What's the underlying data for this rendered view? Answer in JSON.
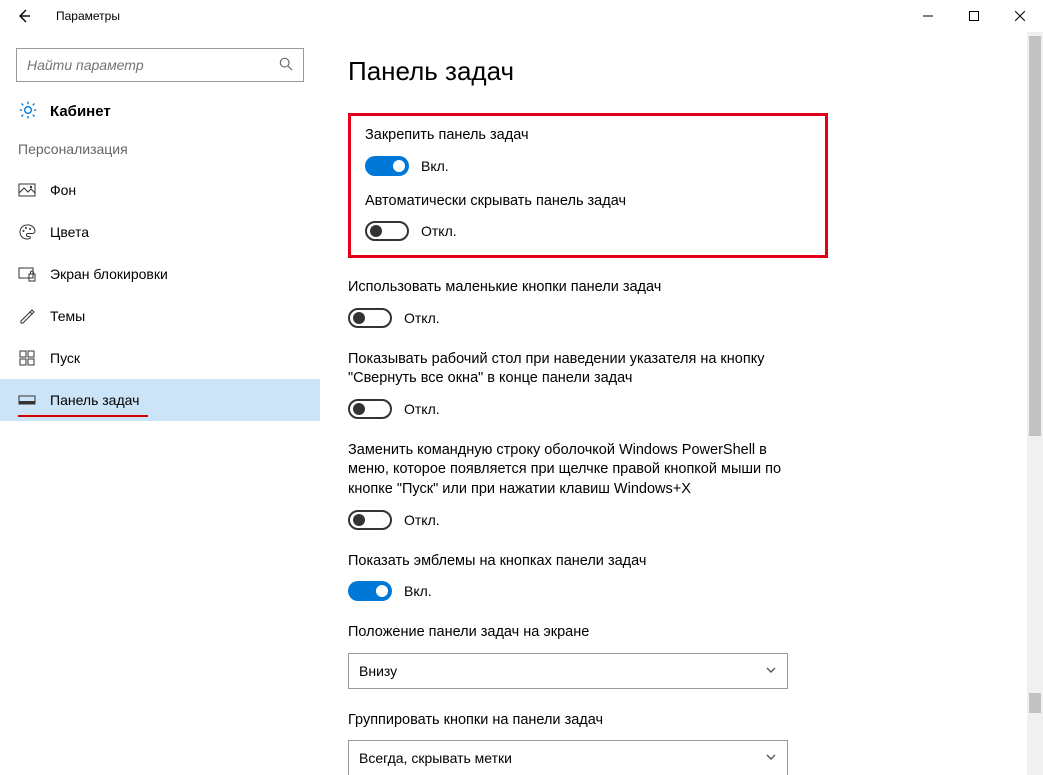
{
  "window": {
    "title": "Параметры"
  },
  "search": {
    "placeholder": "Найти параметр"
  },
  "home": {
    "label": "Кабинет"
  },
  "section_header": "Персонализация",
  "nav": {
    "items": [
      {
        "label": "Фон"
      },
      {
        "label": "Цвета"
      },
      {
        "label": "Экран блокировки"
      },
      {
        "label": "Темы"
      },
      {
        "label": "Пуск"
      },
      {
        "label": "Панель задач"
      }
    ]
  },
  "page": {
    "title": "Панель задач"
  },
  "status": {
    "on": "Вкл.",
    "off": "Откл."
  },
  "settings": {
    "lock": {
      "label": "Закрепить панель задач",
      "on": true
    },
    "autohide": {
      "label": "Автоматически скрывать панель задач",
      "on": false
    },
    "small_buttons": {
      "label": "Использовать маленькие кнопки панели задач",
      "on": false
    },
    "peek": {
      "label": "Показывать рабочий стол при наведении указателя на кнопку \"Свернуть все окна\" в конце панели задач",
      "on": false
    },
    "powershell": {
      "label": "Заменить командную строку оболочкой Windows PowerShell в меню, которое появляется при щелчке правой кнопкой мыши по кнопке \"Пуск\" или при нажатии клавиш Windows+X",
      "on": false
    },
    "badges": {
      "label": "Показать эмблемы на кнопках панели задач",
      "on": true
    }
  },
  "dropdowns": {
    "position": {
      "label": "Положение панели задач на экране",
      "value": "Внизу"
    },
    "grouping": {
      "label": "Группировать кнопки на панели задач",
      "value": "Всегда, скрывать метки"
    }
  }
}
